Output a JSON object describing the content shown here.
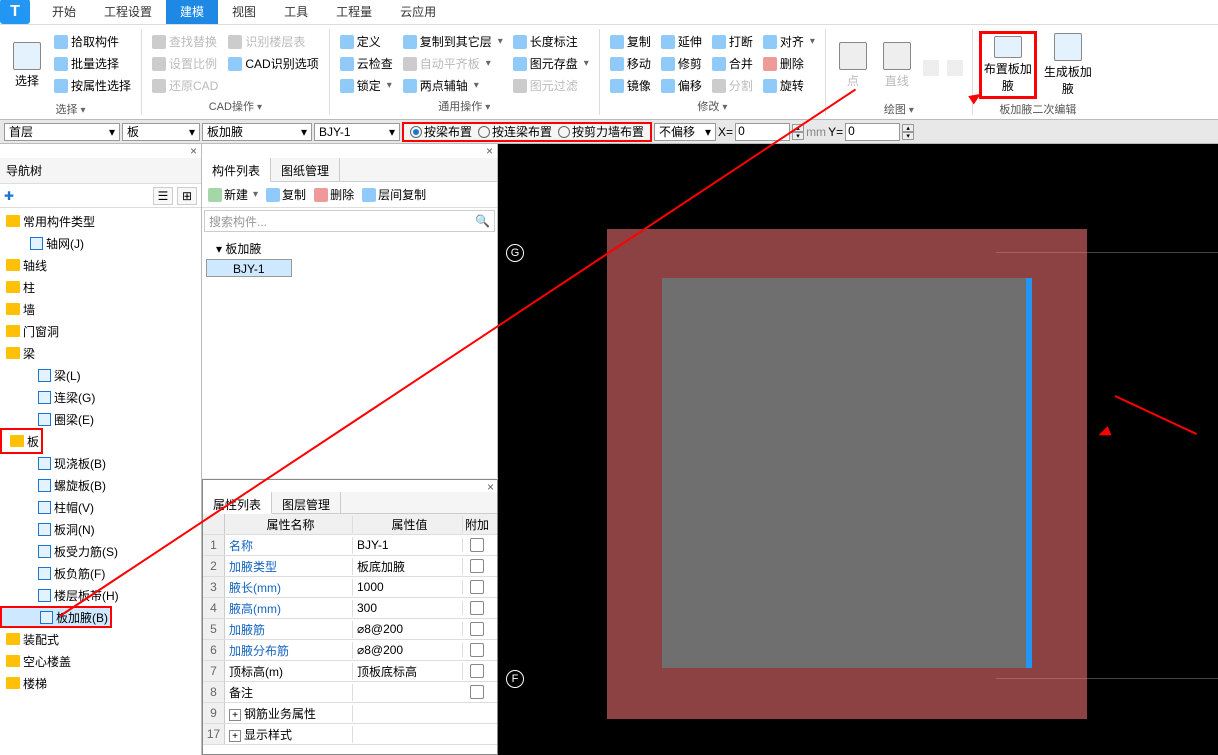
{
  "menu": {
    "tabs": [
      "开始",
      "工程设置",
      "建模",
      "视图",
      "工具",
      "工程量",
      "云应用"
    ],
    "active": 2
  },
  "ribbon": {
    "select": {
      "label": "选择",
      "pick": "拾取构件",
      "batch": "批量选择",
      "byProp": "按属性选择"
    },
    "cadOps": {
      "label": "CAD操作",
      "find": "查找替换",
      "scale": "设置比例",
      "restore": "还原CAD",
      "recog": "识别楼层表",
      "cadOpt": "CAD识别选项"
    },
    "universal": {
      "label": "通用操作",
      "define": "定义",
      "cloud": "云检查",
      "lock": "锁定",
      "copyOther": "复制到其它层",
      "autoAlign": "自动平齐板",
      "twoPt": "两点辅轴",
      "len": "长度标注",
      "disk": "图元存盘",
      "filter": "图元过滤"
    },
    "modify": {
      "label": "修改",
      "copy": "复制",
      "move": "移动",
      "mirror": "镜像",
      "extend": "延伸",
      "trim": "修剪",
      "offset": "偏移",
      "break": "打断",
      "merge": "合并",
      "split": "分割",
      "align": "对齐",
      "delete": "删除",
      "rotate": "旋转"
    },
    "draw": {
      "label": "绘图",
      "point": "点",
      "line": "直线"
    },
    "haunch": {
      "label": "板加腋二次编辑",
      "place": "布置板加腋",
      "gen": "生成板加腋"
    }
  },
  "selectors": {
    "floor": "首层",
    "cat": "板",
    "sub": "板加腋",
    "comp": "BJY-1",
    "r1": "按梁布置",
    "r2": "按连梁布置",
    "r3": "按剪力墙布置",
    "offset": "不偏移",
    "x": "X=",
    "xval": "0",
    "mm": "mm",
    "y": "Y=",
    "yval": "0"
  },
  "nav": {
    "title": "导航树",
    "items": [
      {
        "label": "常用构件类型",
        "type": "folder"
      },
      {
        "label": "轴网(J)",
        "type": "item",
        "indent": 2,
        "ico": "grid"
      },
      {
        "label": "轴线",
        "type": "folder"
      },
      {
        "label": "柱",
        "type": "folder"
      },
      {
        "label": "墙",
        "type": "folder"
      },
      {
        "label": "门窗洞",
        "type": "folder"
      },
      {
        "label": "梁",
        "type": "folder",
        "open": true
      },
      {
        "label": "梁(L)",
        "type": "item",
        "indent": 3
      },
      {
        "label": "连梁(G)",
        "type": "item",
        "indent": 3
      },
      {
        "label": "圈梁(E)",
        "type": "item",
        "indent": 3
      },
      {
        "label": "板",
        "type": "folder",
        "open": true,
        "hl": true
      },
      {
        "label": "现浇板(B)",
        "type": "item",
        "indent": 3
      },
      {
        "label": "螺旋板(B)",
        "type": "item",
        "indent": 3
      },
      {
        "label": "柱帽(V)",
        "type": "item",
        "indent": 3
      },
      {
        "label": "板洞(N)",
        "type": "item",
        "indent": 3
      },
      {
        "label": "板受力筋(S)",
        "type": "item",
        "indent": 3
      },
      {
        "label": "板负筋(F)",
        "type": "item",
        "indent": 3
      },
      {
        "label": "楼层板带(H)",
        "type": "item",
        "indent": 3
      },
      {
        "label": "板加腋(B)",
        "type": "item",
        "indent": 3,
        "sel": true,
        "hl2": true
      },
      {
        "label": "装配式",
        "type": "folder"
      },
      {
        "label": "空心楼盖",
        "type": "folder"
      },
      {
        "label": "楼梯",
        "type": "folder"
      }
    ]
  },
  "compList": {
    "tab1": "构件列表",
    "tab2": "图纸管理",
    "new": "新建",
    "copy": "复制",
    "delete": "删除",
    "layerCopy": "层间复制",
    "search": "搜索构件...",
    "root": "板加腋",
    "item": "BJY-1"
  },
  "prop": {
    "tab1": "属性列表",
    "tab2": "图层管理",
    "h1": "属性名称",
    "h2": "属性值",
    "h3": "附加",
    "rows": [
      {
        "n": "1",
        "name": "名称",
        "val": "BJY-1",
        "link": true,
        "chk": false
      },
      {
        "n": "2",
        "name": "加腋类型",
        "val": "板底加腋",
        "link": true,
        "chk": true
      },
      {
        "n": "3",
        "name": "腋长(mm)",
        "val": "1000",
        "link": true,
        "chk": true
      },
      {
        "n": "4",
        "name": "腋高(mm)",
        "val": "300",
        "link": true,
        "chk": true
      },
      {
        "n": "5",
        "name": "加腋筋",
        "val": "⌀8@200",
        "link": true,
        "chk": true
      },
      {
        "n": "6",
        "name": "加腋分布筋",
        "val": "⌀8@200",
        "link": true,
        "chk": true
      },
      {
        "n": "7",
        "name": "顶标高(m)",
        "val": "顶板底标高",
        "link": false,
        "chk": true
      },
      {
        "n": "8",
        "name": "备注",
        "val": "",
        "link": false,
        "chk": true
      },
      {
        "n": "9",
        "name": "钢筋业务属性",
        "val": "",
        "exp": "+"
      },
      {
        "n": "17",
        "name": "显示样式",
        "val": "",
        "exp": "+"
      }
    ]
  },
  "axes": {
    "g": "G",
    "f": "F"
  }
}
